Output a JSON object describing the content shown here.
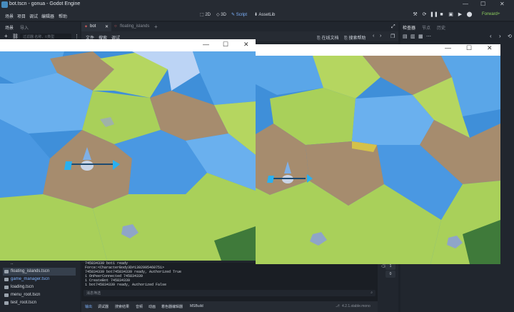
{
  "window": {
    "title": "bot.tscn - gonua - Godot Engine",
    "min": "—",
    "max": "☐",
    "close": "✕"
  },
  "menu": [
    "场景",
    "项目",
    "调试",
    "编辑器",
    "帮助"
  ],
  "workspaces": [
    {
      "label": "2D",
      "active": false
    },
    {
      "label": "3D",
      "active": false
    },
    {
      "label": "Script",
      "active": true
    },
    {
      "label": "AssetLib",
      "active": false
    }
  ],
  "renderer": "Forward+",
  "left_dock": {
    "tabs": [
      "场景",
      "导入"
    ],
    "filter_placeholder": "过滤器 名称、t:类型",
    "files": [
      {
        "name": "..",
        "selected": false
      },
      {
        "name": "floating_islands.tscn",
        "selected": true
      },
      {
        "name": "game_manager.tscn",
        "selected": false
      },
      {
        "name": "loading.tscn",
        "selected": false
      },
      {
        "name": "menu_root.tscn",
        "selected": false
      },
      {
        "name": "test_root.tscn",
        "selected": false
      }
    ]
  },
  "editor_tabs": [
    {
      "label": "bot",
      "active": true
    },
    {
      "label": "floating_islands",
      "active": false
    }
  ],
  "editor_tab_add": "+",
  "script_menu": [
    "文件",
    "搜索",
    "调试"
  ],
  "script_toolbar": {
    "online_docs": "在线文档",
    "search_help": "搜索帮助"
  },
  "output": {
    "lines": [
      "745834339 bot1 ready",
      "Force:<CharacterBody3D#1392995460751>",
      "745834339 bot745834339 ready, Authorized True",
      "1 OnPeerConnected 745834339",
      "1 CreateBot 745834339",
      "1 bot745834339 ready, Authorized False"
    ],
    "filter_placeholder": "消息筛选",
    "tabs": [
      {
        "label": "输出",
        "active": true
      },
      {
        "label": "调试器",
        "active": false
      },
      {
        "label": "搜索结果",
        "active": false
      },
      {
        "label": "音频",
        "active": false
      },
      {
        "label": "动画",
        "active": false
      },
      {
        "label": "着色器编辑器",
        "active": false
      },
      {
        "label": "MSBuild",
        "active": false
      }
    ],
    "version": "4.2.1.stable.mono",
    "counts": [
      "1",
      "0"
    ]
  },
  "inspector_tabs": [
    {
      "label": "检查器",
      "active": true
    },
    {
      "label": "节点",
      "active": false
    },
    {
      "label": "历史",
      "active": false
    }
  ],
  "game_windows": {
    "min": "—",
    "max": "☐",
    "close": "✕"
  },
  "colors": {
    "accent": "#478cbf",
    "grass": "#a9d05a",
    "water": "#3f8fd9",
    "dirt": "#a68c6e"
  }
}
